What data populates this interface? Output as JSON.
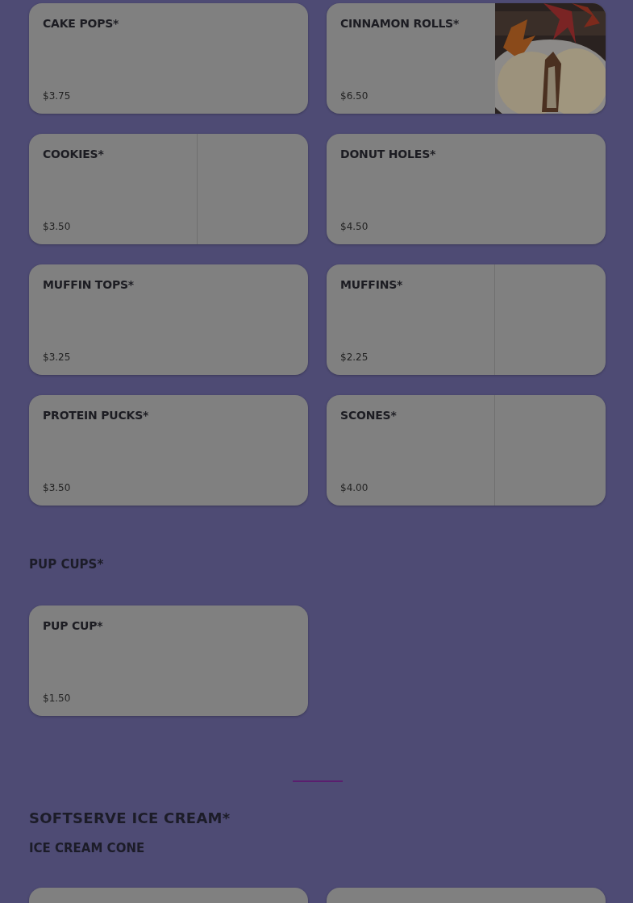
{
  "sections": [
    {
      "items": [
        {
          "kind": "plain",
          "name": "CAKE POPS*",
          "price": "$3.75"
        },
        {
          "name": "CINNAMON ROLLS*",
          "price": "$6.50"
        },
        {
          "kind": "placeholder",
          "name": "COOKIES*",
          "price": "$3.50"
        },
        {
          "kind": "plain",
          "name": "DONUT HOLES*",
          "price": "$4.50"
        },
        {
          "kind": "plain",
          "name": "MUFFIN TOPS*",
          "price": "$3.25"
        },
        {
          "kind": "placeholder",
          "name": "MUFFINS*",
          "price": "$2.25"
        },
        {
          "kind": "plain",
          "name": "PROTEIN PUCKS*",
          "price": "$3.50"
        },
        {
          "kind": "placeholder",
          "name": "SCONES*",
          "price": "$4.00"
        }
      ]
    },
    {
      "heading": "PUP CUPS*",
      "items": [
        {
          "kind": "plain",
          "name": "PUP CUP*",
          "price": "$1.50"
        }
      ]
    },
    {
      "divider": true,
      "heading": "SOFTSERVE ICE CREAM*",
      "subheading": "ICE CREAM CONE",
      "items": [
        {
          "kind": "cut"
        },
        {
          "kind": "cut"
        }
      ]
    }
  ]
}
